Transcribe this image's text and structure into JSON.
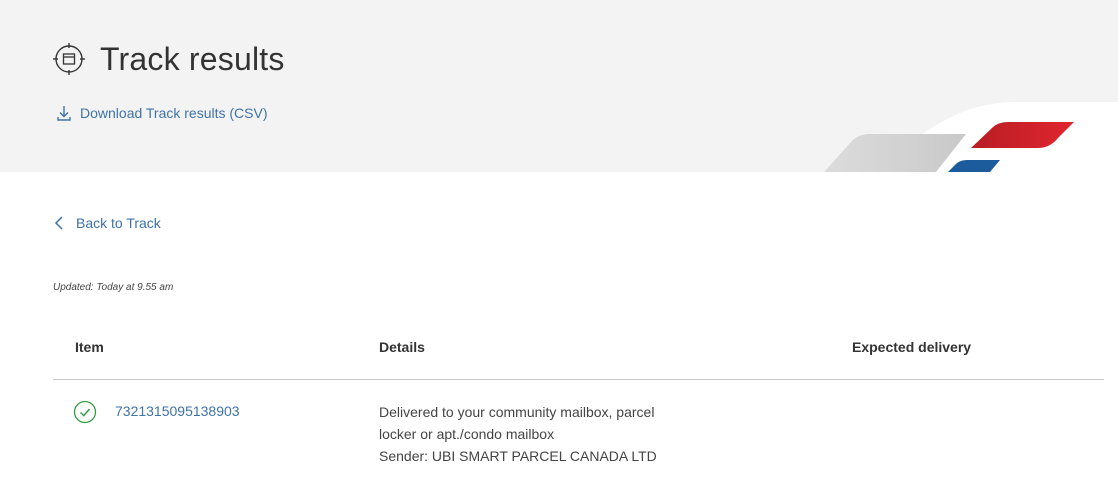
{
  "header": {
    "title": "Track results",
    "download_label": "Download Track results (CSV)"
  },
  "nav": {
    "back_label": "Back to Track"
  },
  "updated_text": "Updated: Today at 9.55 am",
  "table": {
    "columns": [
      "Item",
      "Details",
      "Expected delivery"
    ],
    "rows": [
      {
        "status_icon": "check-circle-icon",
        "item": "7321315095138903",
        "details": {
          "line1": "Delivered to your community mailbox, parcel",
          "line2": "locker or apt./condo mailbox",
          "sender": "Sender: UBI SMART PARCEL CANADA LTD"
        },
        "expected_delivery": ""
      }
    ]
  },
  "colors": {
    "link": "#3d73a8",
    "banner_bg": "#f4f3f3",
    "brand_red": "#d8242c",
    "brand_blue": "#1c5b9c",
    "success_green": "#2e9e3f"
  }
}
